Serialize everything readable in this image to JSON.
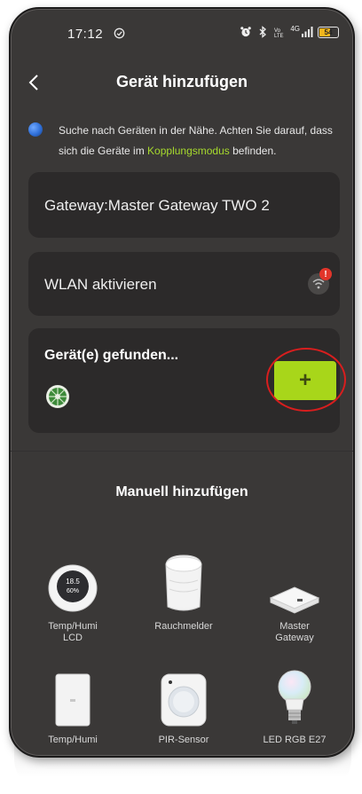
{
  "status_bar": {
    "time": "17:12",
    "battery": "54",
    "network": "4G"
  },
  "header": {
    "title": "Gerät hinzufügen"
  },
  "hint": {
    "text_before": "Suche nach Geräten in der Nähe. Achten Sie darauf, dass sich die Geräte im ",
    "highlight": "Kopplungsmodus",
    "text_after": " befinden.",
    "highlight_color": "#a6d92d"
  },
  "gateway_card": {
    "label": "Gateway:Master Gateway TWO 2"
  },
  "wlan_card": {
    "label": "WLAN aktivieren",
    "badge": "!"
  },
  "found_card": {
    "title": "Gerät(e) gefunden...",
    "add_label": "+",
    "accent_color": "#a8d61a"
  },
  "manual": {
    "title": "Manuell hinzufügen",
    "devices": [
      {
        "label": "Temp/Humi\nLCD",
        "icon": "temp-humi-lcd-sensor-icon"
      },
      {
        "label": "Rauchmelder",
        "icon": "smoke-detector-icon"
      },
      {
        "label": "Master\nGateway",
        "icon": "master-gateway-icon"
      },
      {
        "label": "Temp/Humi",
        "icon": "temp-humi-sensor-icon"
      },
      {
        "label": "PIR-Sensor",
        "icon": "pir-sensor-icon"
      },
      {
        "label": "LED RGB E27",
        "icon": "led-bulb-icon"
      }
    ]
  }
}
